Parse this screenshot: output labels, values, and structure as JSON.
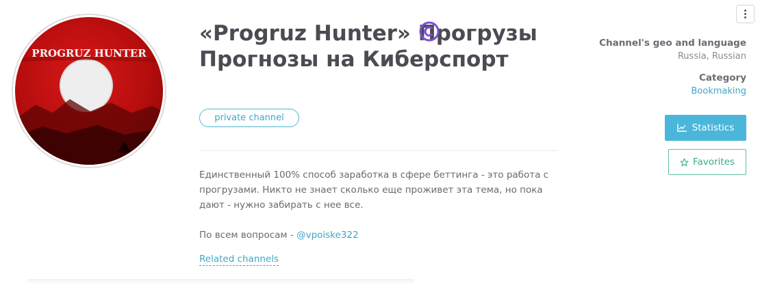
{
  "channel": {
    "title": "«Progruz Hunter» Прогрузы Прогнозы на Киберспорт",
    "avatar_text": "PROGRUZ HUNTER",
    "badge_label": "private channel",
    "description_line1": "Единственный 100% способ заработка в сфере беттинга - это работа с прогрузами. Никто не знает сколько еще проживет эта тема, но пока дают - нужно забирать с нее все.",
    "contact_prefix": "По всем вопросам - ",
    "contact_handle": "@vpoiske322",
    "related_label": "Related channels"
  },
  "sidebar": {
    "geo_label": "Channel's geo and language",
    "geo_value": "Russia, Russian",
    "category_label": "Category",
    "category_value": "Bookmaking",
    "statistics_label": "Statistics",
    "favorites_label": "Favorites"
  },
  "colors": {
    "accent": "#4ab6d9",
    "favorite": "#3aa98b",
    "verified": "#7b4fd6",
    "avatar_red": "#c41212"
  },
  "icons": {
    "verified": "copyright-circle-icon",
    "statistics": "line-chart-icon",
    "favorites": "star-outline-icon",
    "menu": "vertical-dots-icon"
  }
}
